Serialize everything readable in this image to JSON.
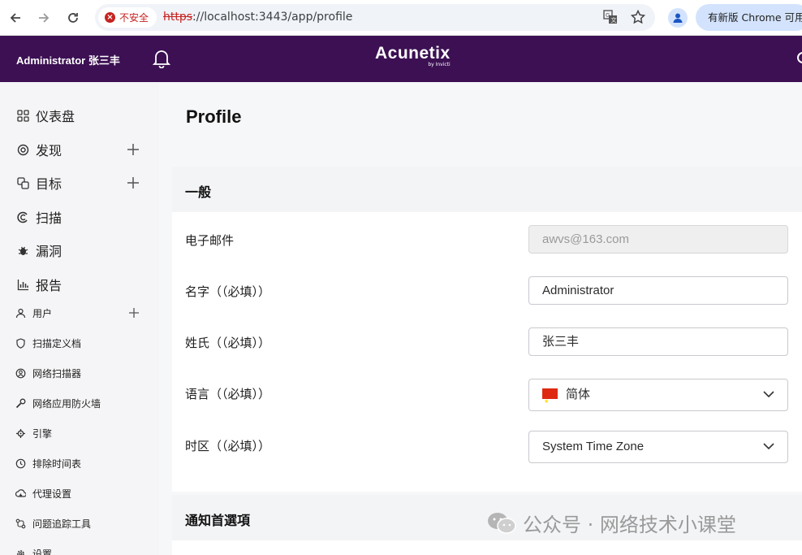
{
  "browser": {
    "security_label": "不安全",
    "url_scheme": "https",
    "url_rest": "://localhost:3443/app/profile",
    "update_label": "有新版 Chrome 可用"
  },
  "header": {
    "user_name": "Administrator 张三丰",
    "logo_brand": "Acunetix",
    "logo_sub": "by Invicti"
  },
  "sidebar": {
    "items": [
      {
        "label": "仪表盘",
        "icon": "dashboard-icon"
      },
      {
        "label": "发现",
        "icon": "target-icon"
      },
      {
        "label": "目标",
        "icon": "targets-icon"
      },
      {
        "label": "扫描",
        "icon": "scan-icon"
      },
      {
        "label": "漏洞",
        "icon": "bug-icon"
      },
      {
        "label": "报告",
        "icon": "report-icon"
      },
      {
        "label": "用户",
        "icon": "user-icon"
      },
      {
        "label": "扫描定义档",
        "icon": "shield-icon"
      },
      {
        "label": "网络扫描器",
        "icon": "network-scanner-icon"
      },
      {
        "label": "网络应用防火墙",
        "icon": "wrench-icon"
      },
      {
        "label": "引擎",
        "icon": "engine-icon"
      },
      {
        "label": "排除时间表",
        "icon": "clock-icon"
      },
      {
        "label": "代理设置",
        "icon": "proxy-icon"
      },
      {
        "label": "问题追踪工具",
        "icon": "tracker-icon"
      },
      {
        "label": "设置",
        "icon": "gear-icon"
      }
    ]
  },
  "main": {
    "page_title": "Profile",
    "general_title": "一般",
    "email_label": "电子邮件",
    "email_value": "awvs@163.com",
    "first_name_label": "名字（（必填））",
    "first_name_value": "Administrator",
    "last_name_label": "姓氏（（必填））",
    "last_name_value": "张三丰",
    "language_label": "语言（（必填））",
    "language_value": "简体",
    "timezone_label": "时区（（必填））",
    "timezone_value": "System Time Zone",
    "notifications_title": "通知首選項"
  },
  "watermark": {
    "text": "公众号 · 网络技术小课堂"
  },
  "colors": {
    "header_bg": "#3c1053",
    "sidebar_bg": "#f5f5f7",
    "insecure_red": "#c5221f"
  }
}
